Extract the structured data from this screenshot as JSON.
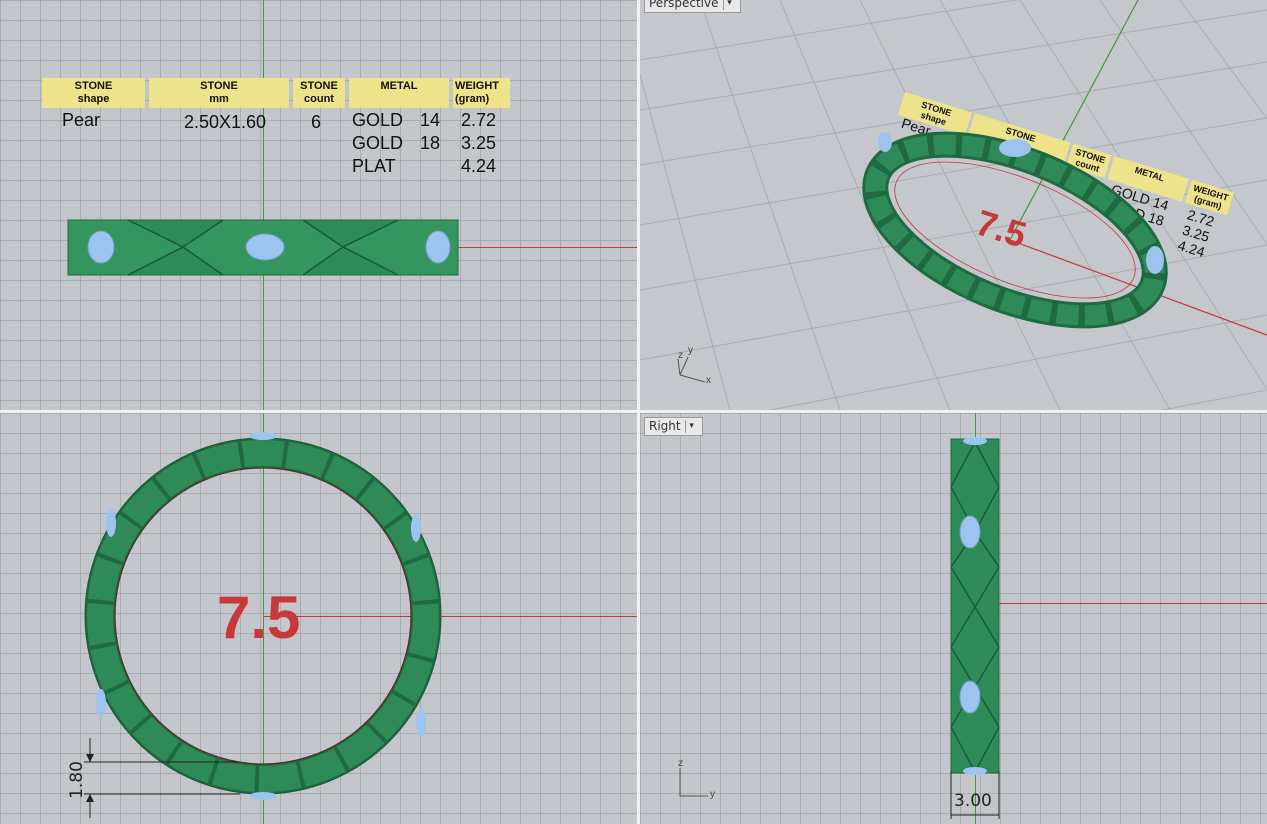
{
  "app": {
    "colors": {
      "metal": "#2e8a57",
      "metal_dark": "#1f6a40",
      "stone": "#9cc4ee",
      "axis_x": "#c23a3a",
      "axis_y": "#3f9b3f",
      "table_header": "#ede38a"
    }
  },
  "viewports": {
    "perspective": {
      "label": "Perspective"
    },
    "right": {
      "label": "Right"
    }
  },
  "spec_table": {
    "headers": [
      {
        "line1": "STONE",
        "line2": "shape"
      },
      {
        "line1": "STONE",
        "line2": "mm"
      },
      {
        "line1": "STONE",
        "line2": "count"
      },
      {
        "line1": "METAL",
        "line2": ""
      },
      {
        "line1": "WEIGHT",
        "line2": "(gram)"
      }
    ],
    "shape": "Pear",
    "mm": "2.50X1.60",
    "count": "6",
    "metals": [
      {
        "metal": "GOLD",
        "karat": "14",
        "weight": "2.72"
      },
      {
        "metal": "GOLD",
        "karat": "18",
        "weight": "3.25"
      },
      {
        "metal": "PLAT",
        "karat": "",
        "weight": "4.24"
      }
    ]
  },
  "ring_size": "7.5",
  "dimensions": {
    "thickness": "1.80",
    "width": "3.00"
  },
  "axes": {
    "x": "x",
    "y": "y",
    "z": "z"
  }
}
